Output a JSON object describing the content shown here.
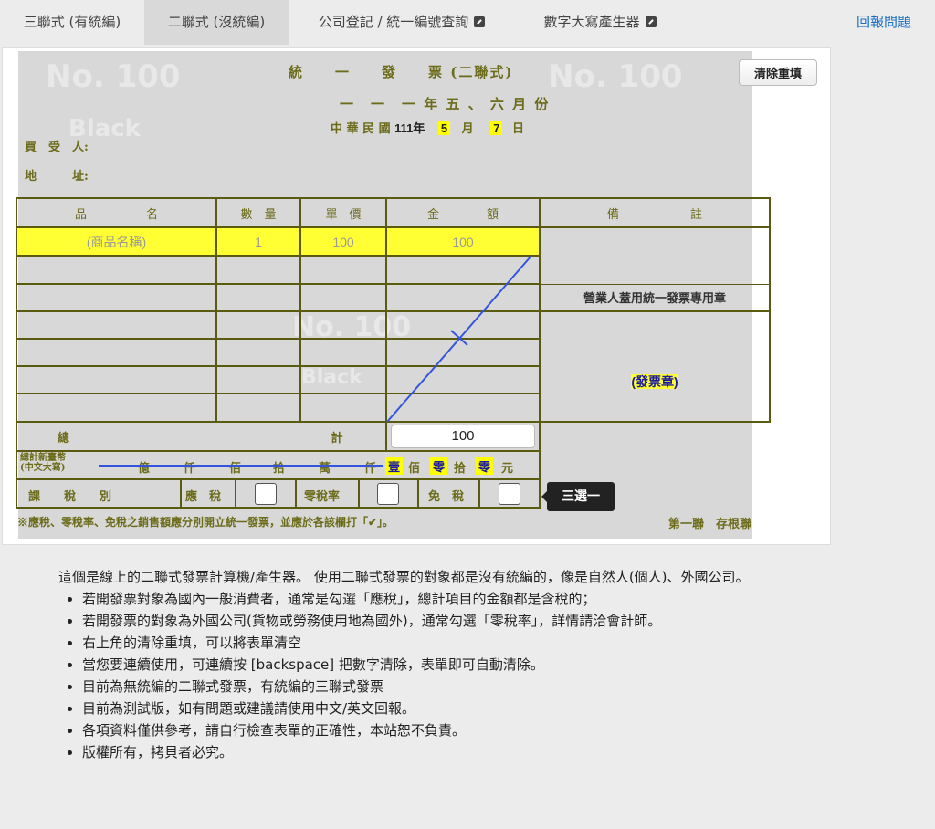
{
  "nav": {
    "tabs": [
      {
        "label": "三聯式 (有統編)"
      },
      {
        "label": "二聯式 (沒統編)"
      },
      {
        "label": "公司登記 / 統一編號查詢"
      },
      {
        "label": "數字大寫產生器"
      }
    ],
    "report_label": "回報問題"
  },
  "invoice": {
    "clear_label": "清除重填",
    "title": "統　　一　　發　　票 (二聯式)",
    "period": "一　一　一 年 五 、 六 月 份",
    "date_prefix": "中 華 民 國",
    "year": "111年",
    "month_value": "5",
    "month_label": "月",
    "day_value": "7",
    "day_label": "日",
    "buyer_label": "買　受　人:",
    "address_label": "地　　　址:",
    "headers": {
      "name": "品　　　　　名",
      "qty": "數　量",
      "price": "單　價",
      "amount": "金　　　　額",
      "note": "備　　　　　　註"
    },
    "item": {
      "name": "(商品名稱)",
      "qty": "1",
      "price": "100",
      "amount": "100"
    },
    "stamp_label": "營業人蓋用統一發票專用章",
    "stamp_placeholder": "(發票章)",
    "total_label_a": "總",
    "total_label_b": "計",
    "total_value": "100",
    "chinese_total_label": "總計新臺幣\n(中文大寫)",
    "units": {
      "yi": "億",
      "qian1": "仟",
      "bai1": "佰",
      "shi1": "拾",
      "wan": "萬",
      "qian2": "仟",
      "d1": "壹",
      "bai2": "佰",
      "d2": "零",
      "shi2": "拾",
      "d3": "零",
      "yuan": "元"
    },
    "tax_type_label": "課　　稅　　別",
    "tax_taxable": "應　稅",
    "tax_zero": "零稅率",
    "tax_exempt": "免　稅",
    "tooltip": "三選一",
    "footer_note": "※應稅、零稅率、免稅之銷售額應分別開立統一發票，並應於各該欄打「✔」。",
    "copy_label": "第一聯　存根聯",
    "watermarks": [
      "No. 100",
      "Black",
      "No. 100",
      "Black",
      "No. 100"
    ]
  },
  "description": {
    "intro": "這個是線上的二聯式發票計算機/產生器。 使用二聯式發票的對象都是沒有統編的，像是自然人(個人)、外國公司。",
    "bullets": [
      "若開發票對象為國內一般消費者，通常是勾選「應稅」，總計項目的金額都是含稅的；",
      "若開發票的對象為外國公司(貨物或勞務使用地為國外)，通常勾選「零稅率」，詳情請洽會計師。",
      "右上角的清除重填，可以將表單清空",
      "當您要連續使用，可連續按 [backspace] 把數字清除，表單即可自動清除。",
      "目前為無統編的二聯式發票，有統編的三聯式發票",
      "目前為測試版，如有問題或建議請使用中文/英文回報。",
      "各項資料僅供參考，請自行檢查表單的正確性，本站恕不負責。",
      "版權所有，拷貝者必究。"
    ]
  }
}
